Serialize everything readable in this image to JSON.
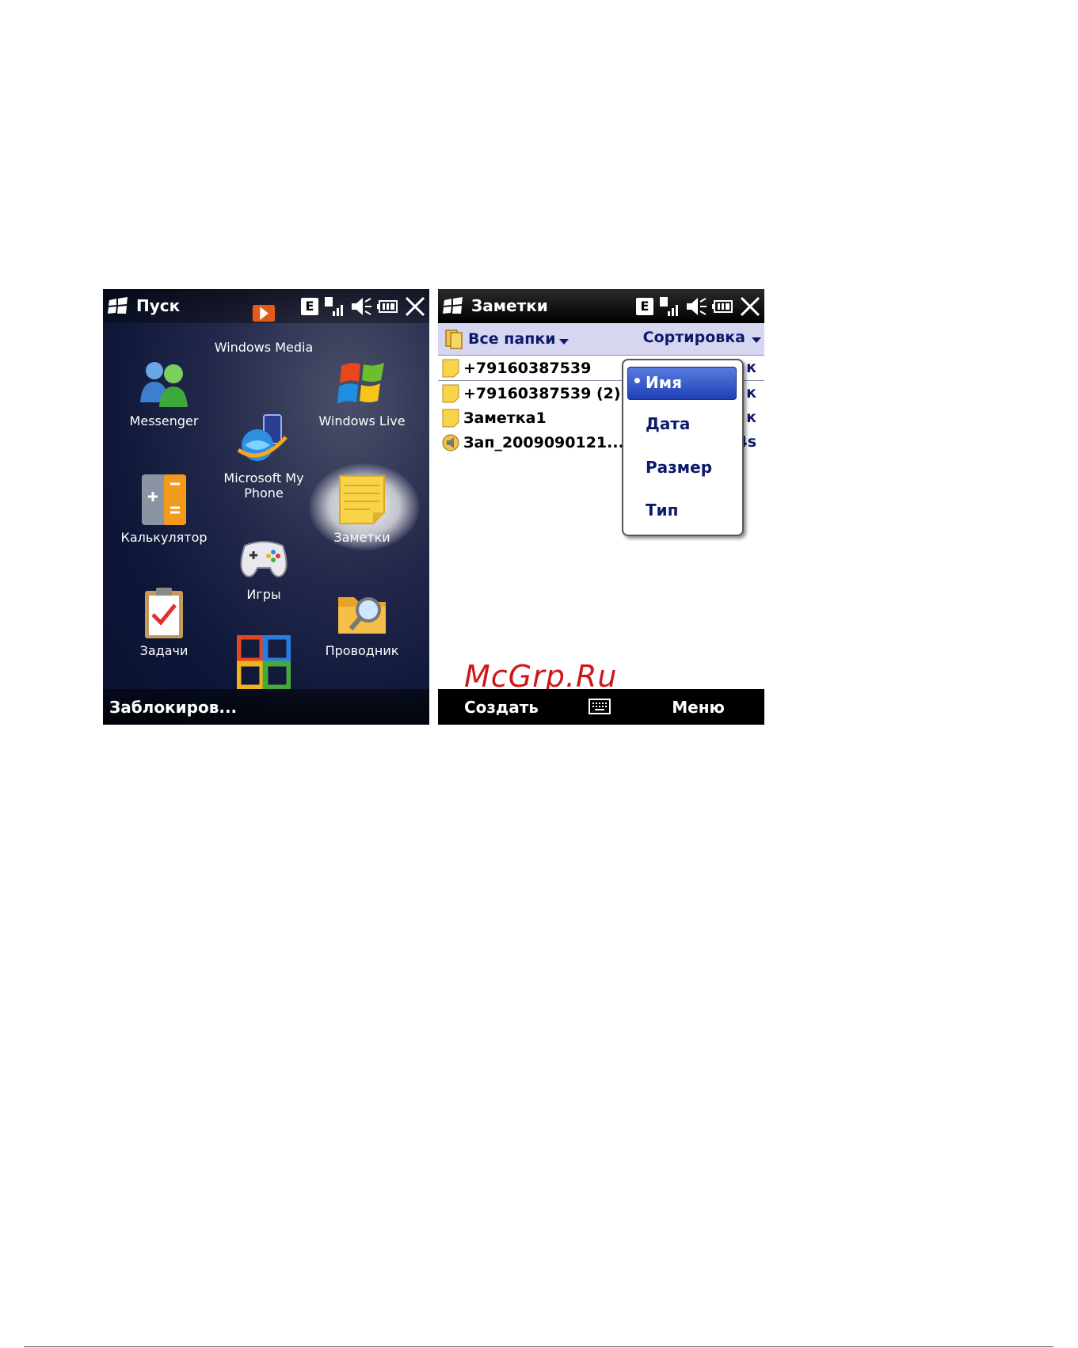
{
  "start_screen": {
    "title": "Пуск",
    "status": {
      "network_letter": "E"
    },
    "tiles": [
      {
        "label": "Windows Media",
        "icon": "windows-media-icon"
      },
      {
        "label": "Messenger",
        "icon": "messenger-icon"
      },
      {
        "label": "Windows Live",
        "icon": "windows-live-icon"
      },
      {
        "label": "Microsoft My Phone",
        "icon": "my-phone-icon"
      },
      {
        "label": "Калькулятор",
        "icon": "calculator-icon"
      },
      {
        "label": "Заметки",
        "icon": "notes-icon"
      },
      {
        "label": "Игры",
        "icon": "games-icon"
      },
      {
        "label": "Задачи",
        "icon": "tasks-icon"
      },
      {
        "label": "Проводник",
        "icon": "explorer-icon"
      },
      {
        "label": "",
        "icon": "office-icon"
      }
    ],
    "softkey_left": "Заблокиров..."
  },
  "notes_screen": {
    "title": "Заметки",
    "status": {
      "network_letter": "E"
    },
    "folder_label": "Все папки",
    "sort_label": "Сортировка",
    "items": [
      {
        "name": "+79160387539",
        "suffix": "к"
      },
      {
        "name": "+79160387539 (2)",
        "suffix": "к"
      },
      {
        "name": "Заметка1",
        "suffix": "к"
      },
      {
        "name": "Зап_2009090121...",
        "suffix": "4s"
      }
    ],
    "sort_menu": {
      "selected": "Имя",
      "options": [
        "Дата",
        "Размер",
        "Тип"
      ]
    },
    "softkey_left": "Создать",
    "softkey_right": "Меню",
    "watermark": "McGrp.Ru"
  },
  "colors": {
    "accent": "#1f3fb5",
    "text_blue": "#0c1a6e",
    "watermark": "#d0161b"
  }
}
